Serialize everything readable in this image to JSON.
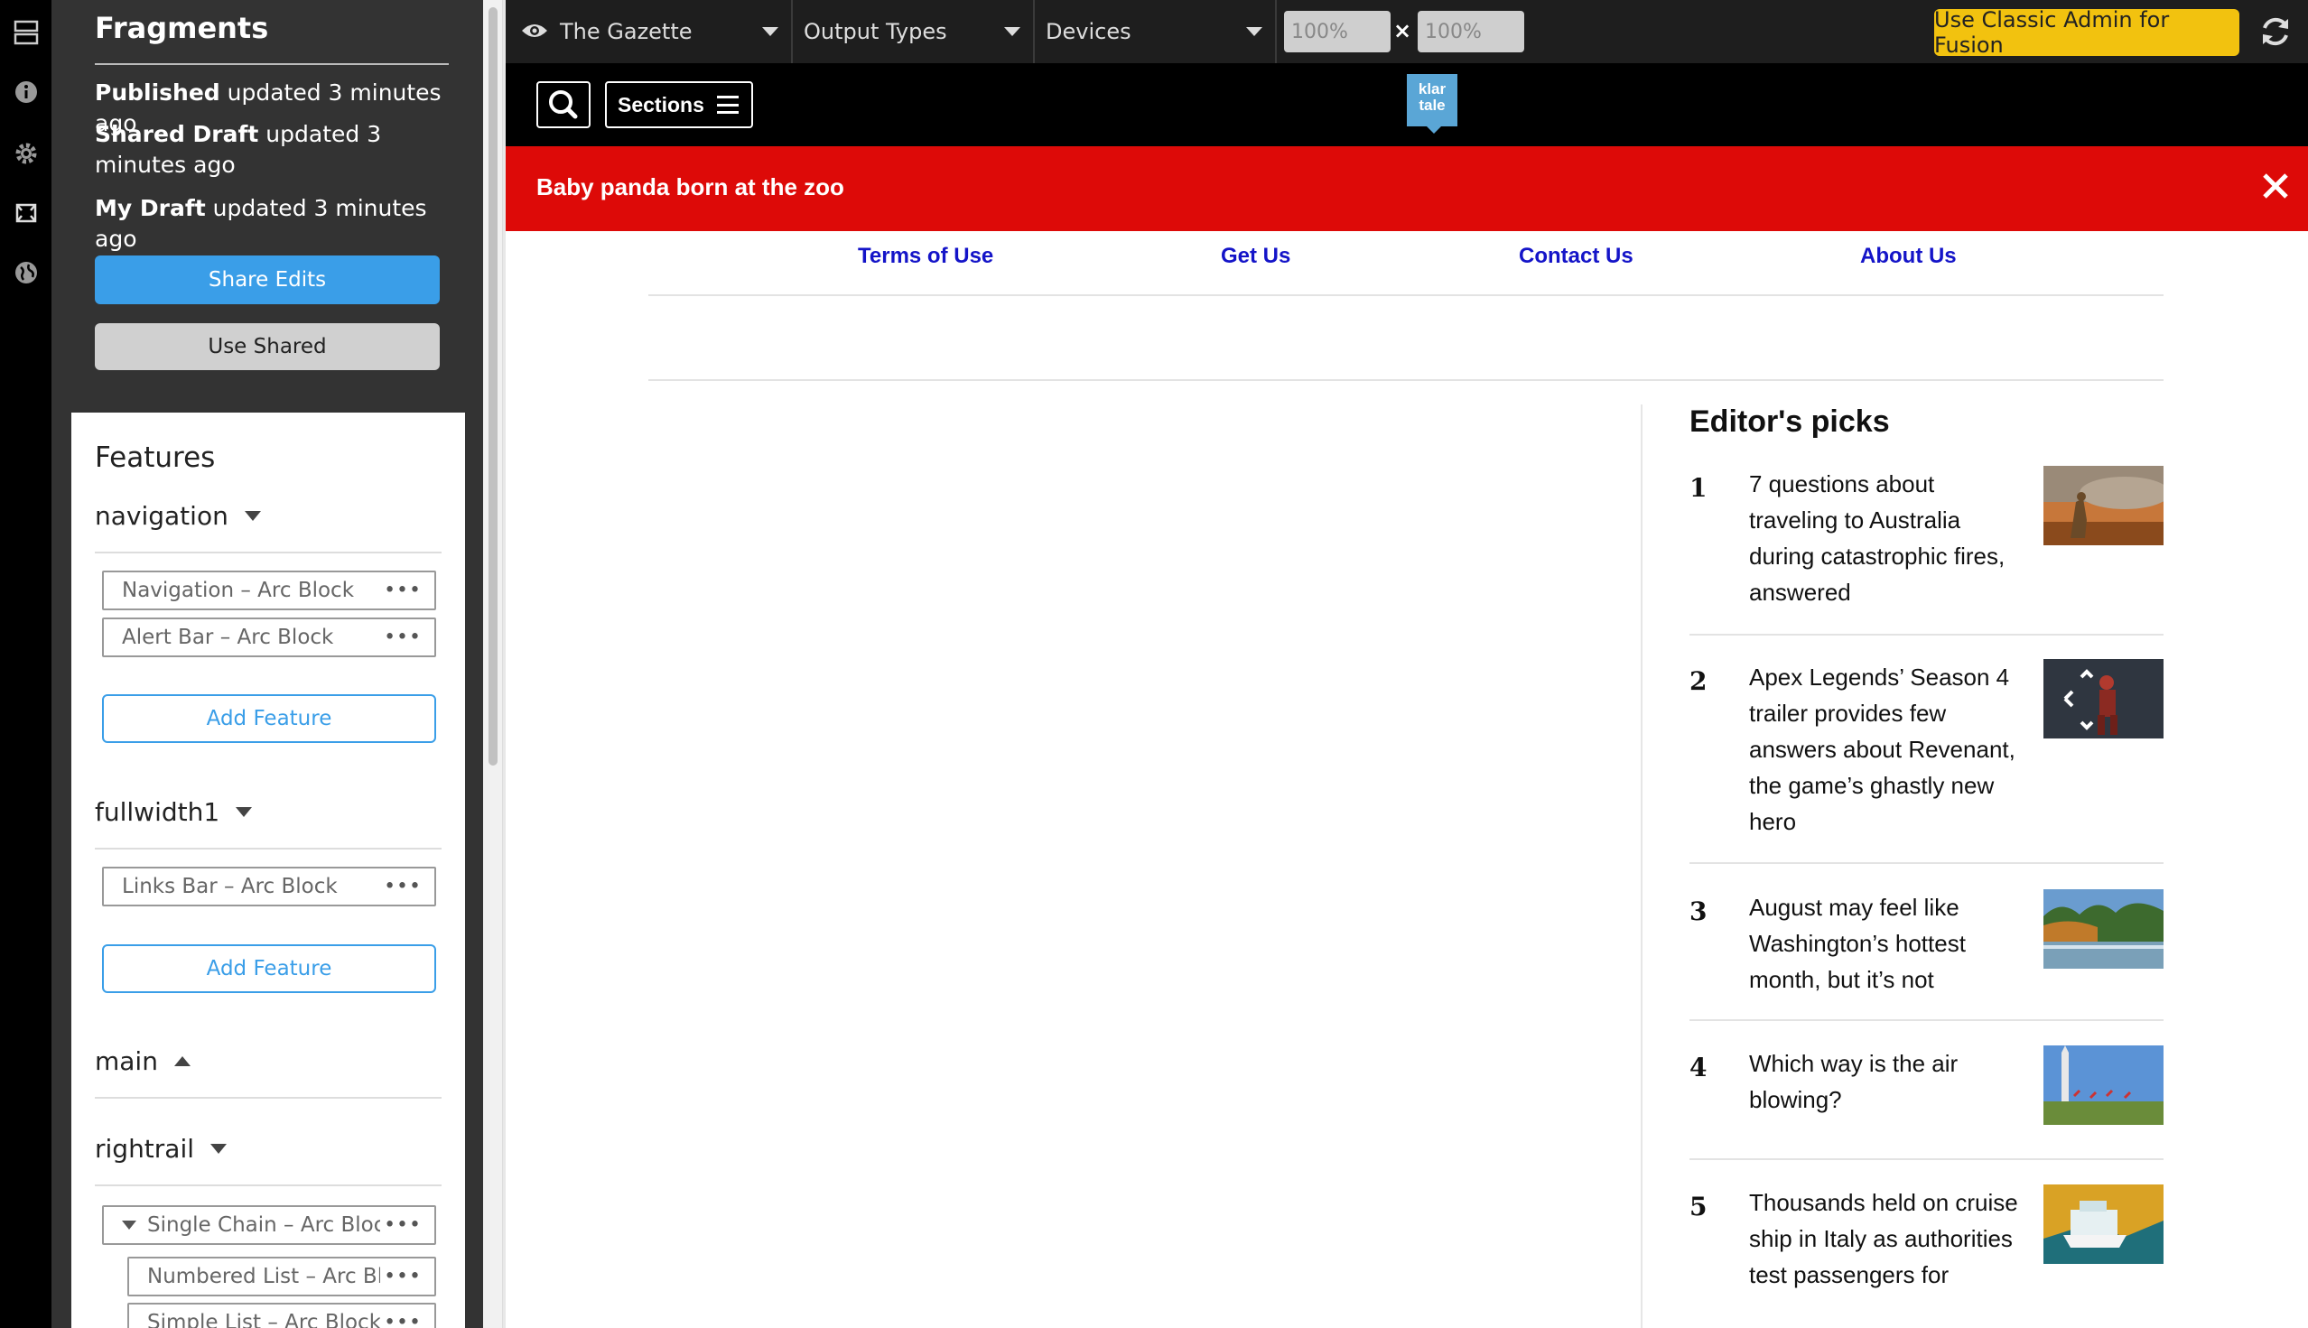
{
  "panel": {
    "title": "Fragments",
    "status": [
      {
        "label": "Published",
        "text": " updated 3 minutes ago"
      },
      {
        "label": "Shared Draft",
        "text": " updated 3 minutes ago"
      },
      {
        "label": "My Draft",
        "text": " updated 3 minutes ago"
      }
    ],
    "share_label": "Share Edits",
    "use_shared_label": "Use Shared",
    "features": {
      "title": "Features",
      "sections": [
        {
          "name": "navigation",
          "blocks": [
            "Navigation – Arc Block",
            "Alert Bar – Arc Block"
          ],
          "add_label": "Add Feature"
        },
        {
          "name": "fullwidth1",
          "blocks": [
            "Links Bar – Arc Block"
          ],
          "add_label": "Add Feature"
        },
        {
          "name": "main"
        },
        {
          "name": "rightrail",
          "blocks": [
            "Single Chain – Arc Block",
            "Numbered List – Arc Block",
            "Simple List – Arc Block"
          ]
        }
      ]
    }
  },
  "toolbar": {
    "site": "The Gazette",
    "output_types": "Output Types",
    "devices": "Devices",
    "width": "100%",
    "height": "100%",
    "times": "×",
    "classic_label": "Use Classic Admin for Fusion"
  },
  "preview": {
    "sections_label": "Sections",
    "logo_text": "klar tale",
    "alert": "Baby panda born at the zoo",
    "links": [
      "Terms of Use",
      "Get Us",
      "Contact Us",
      "About Us"
    ],
    "picks_title": "Editor's picks",
    "picks": [
      {
        "num": "1",
        "text": "7 questions about traveling to Australia during catastrophic fires, answered"
      },
      {
        "num": "2",
        "text": "Apex Legends’ Season 4 trailer provides few answers about Revenant, the game’s ghastly new hero"
      },
      {
        "num": "3",
        "text": "August may feel like Washington’s hottest month, but it’s not"
      },
      {
        "num": "4",
        "text": "Which way is the air blowing?"
      },
      {
        "num": "5",
        "text": "Thousands held on cruise ship in Italy as authorities test passengers for"
      }
    ]
  },
  "colors": {
    "alert_red": "#dd0a08",
    "link_blue": "#1414c8",
    "share_blue": "#3a9ee8",
    "classic_yellow": "#f2c20f",
    "panel_bg": "#333333"
  }
}
